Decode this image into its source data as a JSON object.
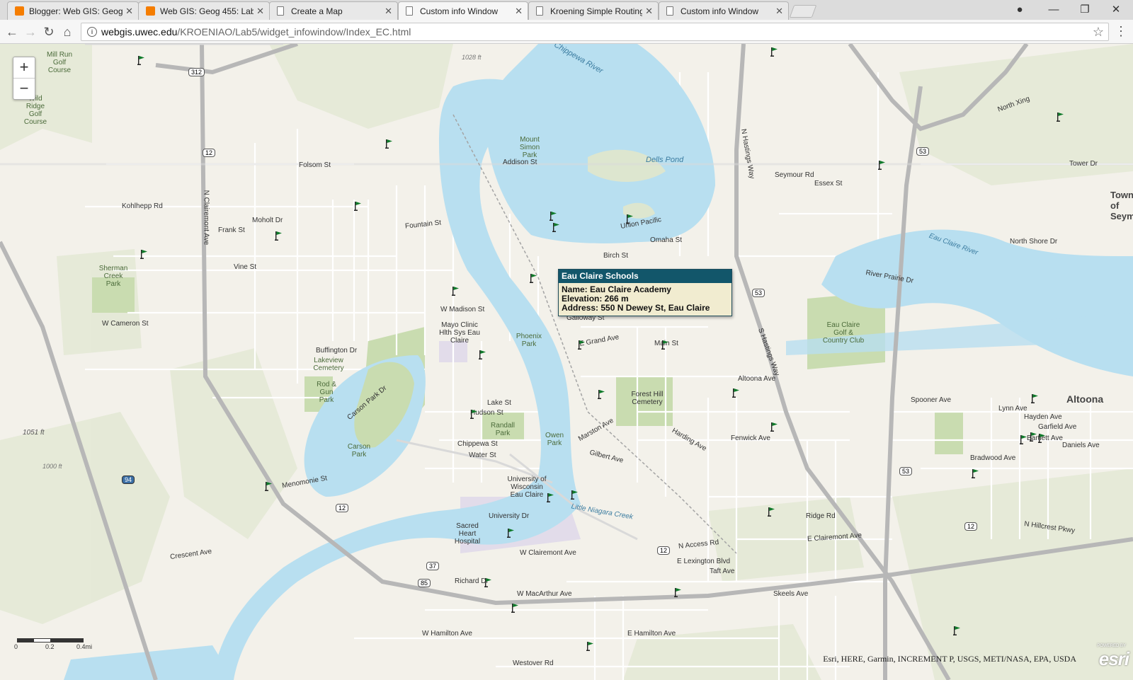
{
  "browser": {
    "tabs": [
      {
        "label": "Blogger: Web GIS: Geog",
        "icon": "blogger-icon"
      },
      {
        "label": "Web GIS: Geog 455: Lab",
        "icon": "blogger-icon"
      },
      {
        "label": "Create a Map",
        "icon": "page-icon"
      },
      {
        "label": "Custom info Window",
        "icon": "page-icon",
        "active": true
      },
      {
        "label": "Kroening Simple Routing",
        "icon": "page-icon"
      },
      {
        "label": "Custom info Window",
        "icon": "page-icon"
      }
    ],
    "url_host": "webgis.uwec.edu",
    "url_path": "/KROENIAO/Lab5/widget_infowindow/Index_EC.html"
  },
  "map": {
    "zoom_in": "+",
    "zoom_out": "−",
    "popup": {
      "title": "Eau Claire Schools",
      "name_line": "Name: Eau Claire Academy",
      "elevation_line": "Elevation: 266 m",
      "address_line": "Address: 550 N Dewey St, Eau Claire"
    },
    "scalebar": {
      "labels": [
        "0",
        "0.2",
        "0.4mi"
      ]
    },
    "attribution": "Esri, HERE, Garmin, INCREMENT P, USGS, METI/NASA, EPA, USDA",
    "esri_logo": "esri",
    "esri_powered": "POWERED BY",
    "labels": {
      "mill_run": "Mill Run Golf Course",
      "wild_ridge": "Wild Ridge Golf Course",
      "chippewa_river": "Chippewa River",
      "dells_pond": "Dells Pond",
      "mount_simon": "Mount Simon Park",
      "addison": "Addison St",
      "folsom": "Folsom St",
      "kohlhepp": "Kohlhepp Rd",
      "moholt": "Moholt Dr",
      "frank": "Frank St",
      "vine": "Vine St",
      "sherman_creek_park": "Sherman Creek Park",
      "w_cameron": "W Cameron St",
      "fountain": "Fountain St",
      "w_madison": "W Madison St",
      "galloway": "Galloway St",
      "mayo": "Mayo Clinic Hlth Sys Eau Claire",
      "phoenix_park": "Phoenix Park",
      "buffington": "Buffington Dr",
      "lakeview": "Lakeview Cemetery",
      "rod_gun": "Rod & Gun Park",
      "carson_park": "Carson Park",
      "carson_park_dr": "Carson Park Dr",
      "lake_st": "Lake St",
      "hudson_st": "Hudson St",
      "randall_park": "Randall Park",
      "chippewa_st": "Chippewa St",
      "water_st": "Water St",
      "owen_park": "Owen Park",
      "uwec": "University of Wisconsin Eau Claire",
      "university_dr": "University Dr",
      "sacred_heart": "Sacred Heart Hospital",
      "little_niagara": "Little Niagara Creek",
      "clairemont_ave": "W Clairemont Ave",
      "e_clairemont": "E Clairemont Ave",
      "richard_dr": "Richard Dr",
      "macarthur": "W MacArthur Ave",
      "w_hamilton": "W Hamilton Ave",
      "e_hamilton": "E Hamilton Ave",
      "westover": "Westover Rd",
      "forest_hill": "Forest Hill Cemetery",
      "altoona": "Altoona",
      "altoona_ave": "Altoona Ave",
      "eau_claire_river": "Eau Claire River",
      "golf_club": "Eau Claire Golf & Country Club",
      "birch_st": "Birch St",
      "omaha_st": "Omaha St",
      "union_pacific": "Union Pacific",
      "essex": "Essex St",
      "seymour": "Seymour Rd",
      "n_hastings": "N Hastings Way",
      "s_hastings": "S Hastings Way",
      "north_xing": "North Xing",
      "north_shore": "North Shore Dr",
      "river_prairie": "River Prairie Dr",
      "tower_dr": "Tower Dr",
      "town_seymour": "Town of Seym",
      "ridge_rd": "Ridge Rd",
      "fenwick": "Fenwick Ave",
      "spooner": "Spooner Ave",
      "lynn": "Lynn Ave",
      "hayden": "Hayden Ave",
      "garfield": "Garfield Ave",
      "bartlett": "Bartlett Ave",
      "daniels": "Daniels Ave",
      "bradwood": "Bradwood Ave",
      "n_hillcrest": "N Hillcrest Pkwy",
      "menomonie": "Menomonie St",
      "crescent": "Crescent Ave",
      "n_access": "N Access Rd",
      "e_lexington": "E Lexington Blvd",
      "taft": "Taft Ave",
      "skeels": "Skeels Ave",
      "main_st": "Main St",
      "harding": "Harding Ave",
      "gilbert": "Gilbert Ave",
      "marston": "Marston Ave",
      "grand_ave": "E Grand Ave",
      "n_clairemont": "N Clairemont Ave",
      "elev_1051": "1051 ft",
      "elev_1028": "1028 ft",
      "elev_1000": "1000 ft",
      "hwy_12": "12",
      "hwy_53": "53",
      "hwy_312": "312",
      "hwy_94": "94",
      "hwy_37": "37",
      "hwy_85": "85"
    }
  }
}
